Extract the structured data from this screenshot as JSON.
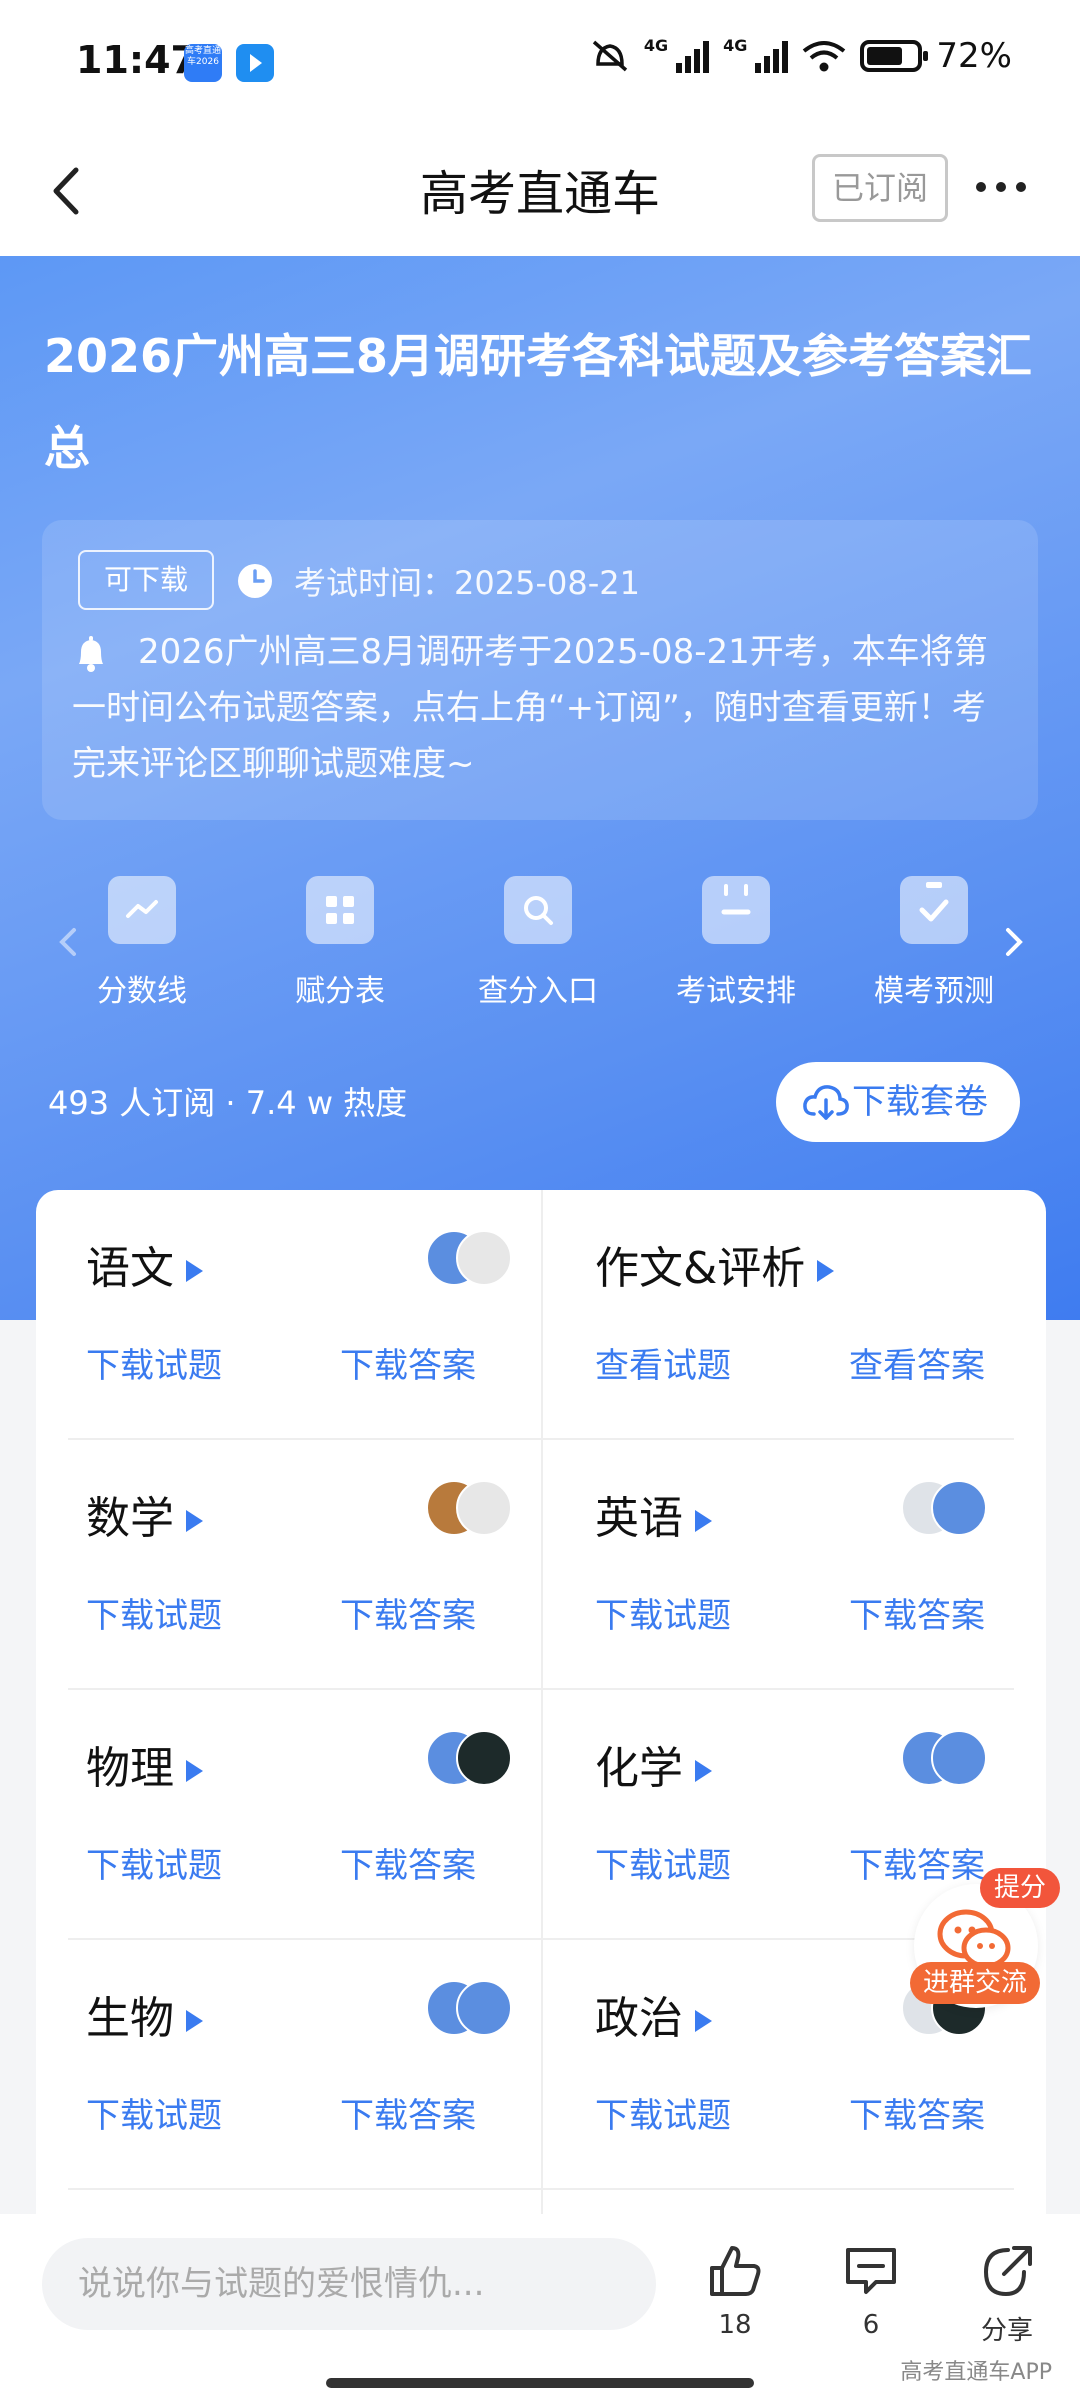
{
  "status_bar": {
    "time": "11:47",
    "battery": "72%",
    "battery_level": 0.72,
    "net1": "4G",
    "net2": "4G",
    "app_badge_text": "高考直通车2026"
  },
  "navbar": {
    "title": "高考直通车",
    "subscribed_label": "已订阅"
  },
  "hero": {
    "title": "2026广州高三8月调研考各科试题及参考答案汇总",
    "download_tag": "可下载",
    "exam_time": "考试时间：2025-08-21",
    "notice": "2026广州高三8月调研考于2025-08-21开考，本车将第一时间公布试题答案，点右上角“+订阅”，随时查看更新！考完来评论区聊聊试题难度~"
  },
  "tools": [
    {
      "label": "分数线",
      "icon": "score-line-icon"
    },
    {
      "label": "赋分表",
      "icon": "grid-icon"
    },
    {
      "label": "查分入口",
      "icon": "search-icon"
    },
    {
      "label": "考试安排",
      "icon": "calendar-icon"
    },
    {
      "label": "模考预测",
      "icon": "check-clipboard-icon"
    }
  ],
  "stats": "493 人订阅 · 7.4 w 热度",
  "download_set": "下载套卷",
  "subjects": [
    {
      "name": "语文",
      "link1": "下载试题",
      "link2": "下载答案"
    },
    {
      "name": "作文&评析",
      "link1": "查看试题",
      "link2": "查看答案"
    },
    {
      "name": "数学",
      "link1": "下载试题",
      "link2": "下载答案"
    },
    {
      "name": "英语",
      "link1": "下载试题",
      "link2": "下载答案"
    },
    {
      "name": "物理",
      "link1": "下载试题",
      "link2": "下载答案"
    },
    {
      "name": "化学",
      "link1": "下载试题",
      "link2": "下载答案"
    },
    {
      "name": "生物",
      "link1": "下载试题",
      "link2": "下载答案"
    },
    {
      "name": "政治",
      "link1": "下载试题",
      "link2": "下载答案"
    }
  ],
  "float": {
    "badge": "提分",
    "label": "进群交流"
  },
  "bottom": {
    "placeholder": "说说你与试题的爱恨情仇...",
    "likes": "18",
    "comments": "6",
    "share": "分享",
    "watermark": "高考直通车APP"
  },
  "colors": {
    "accent": "#3a7bf0",
    "hero_start": "#5d98f5",
    "hero_end": "#3f7cf0",
    "badge": "#f2553b"
  }
}
